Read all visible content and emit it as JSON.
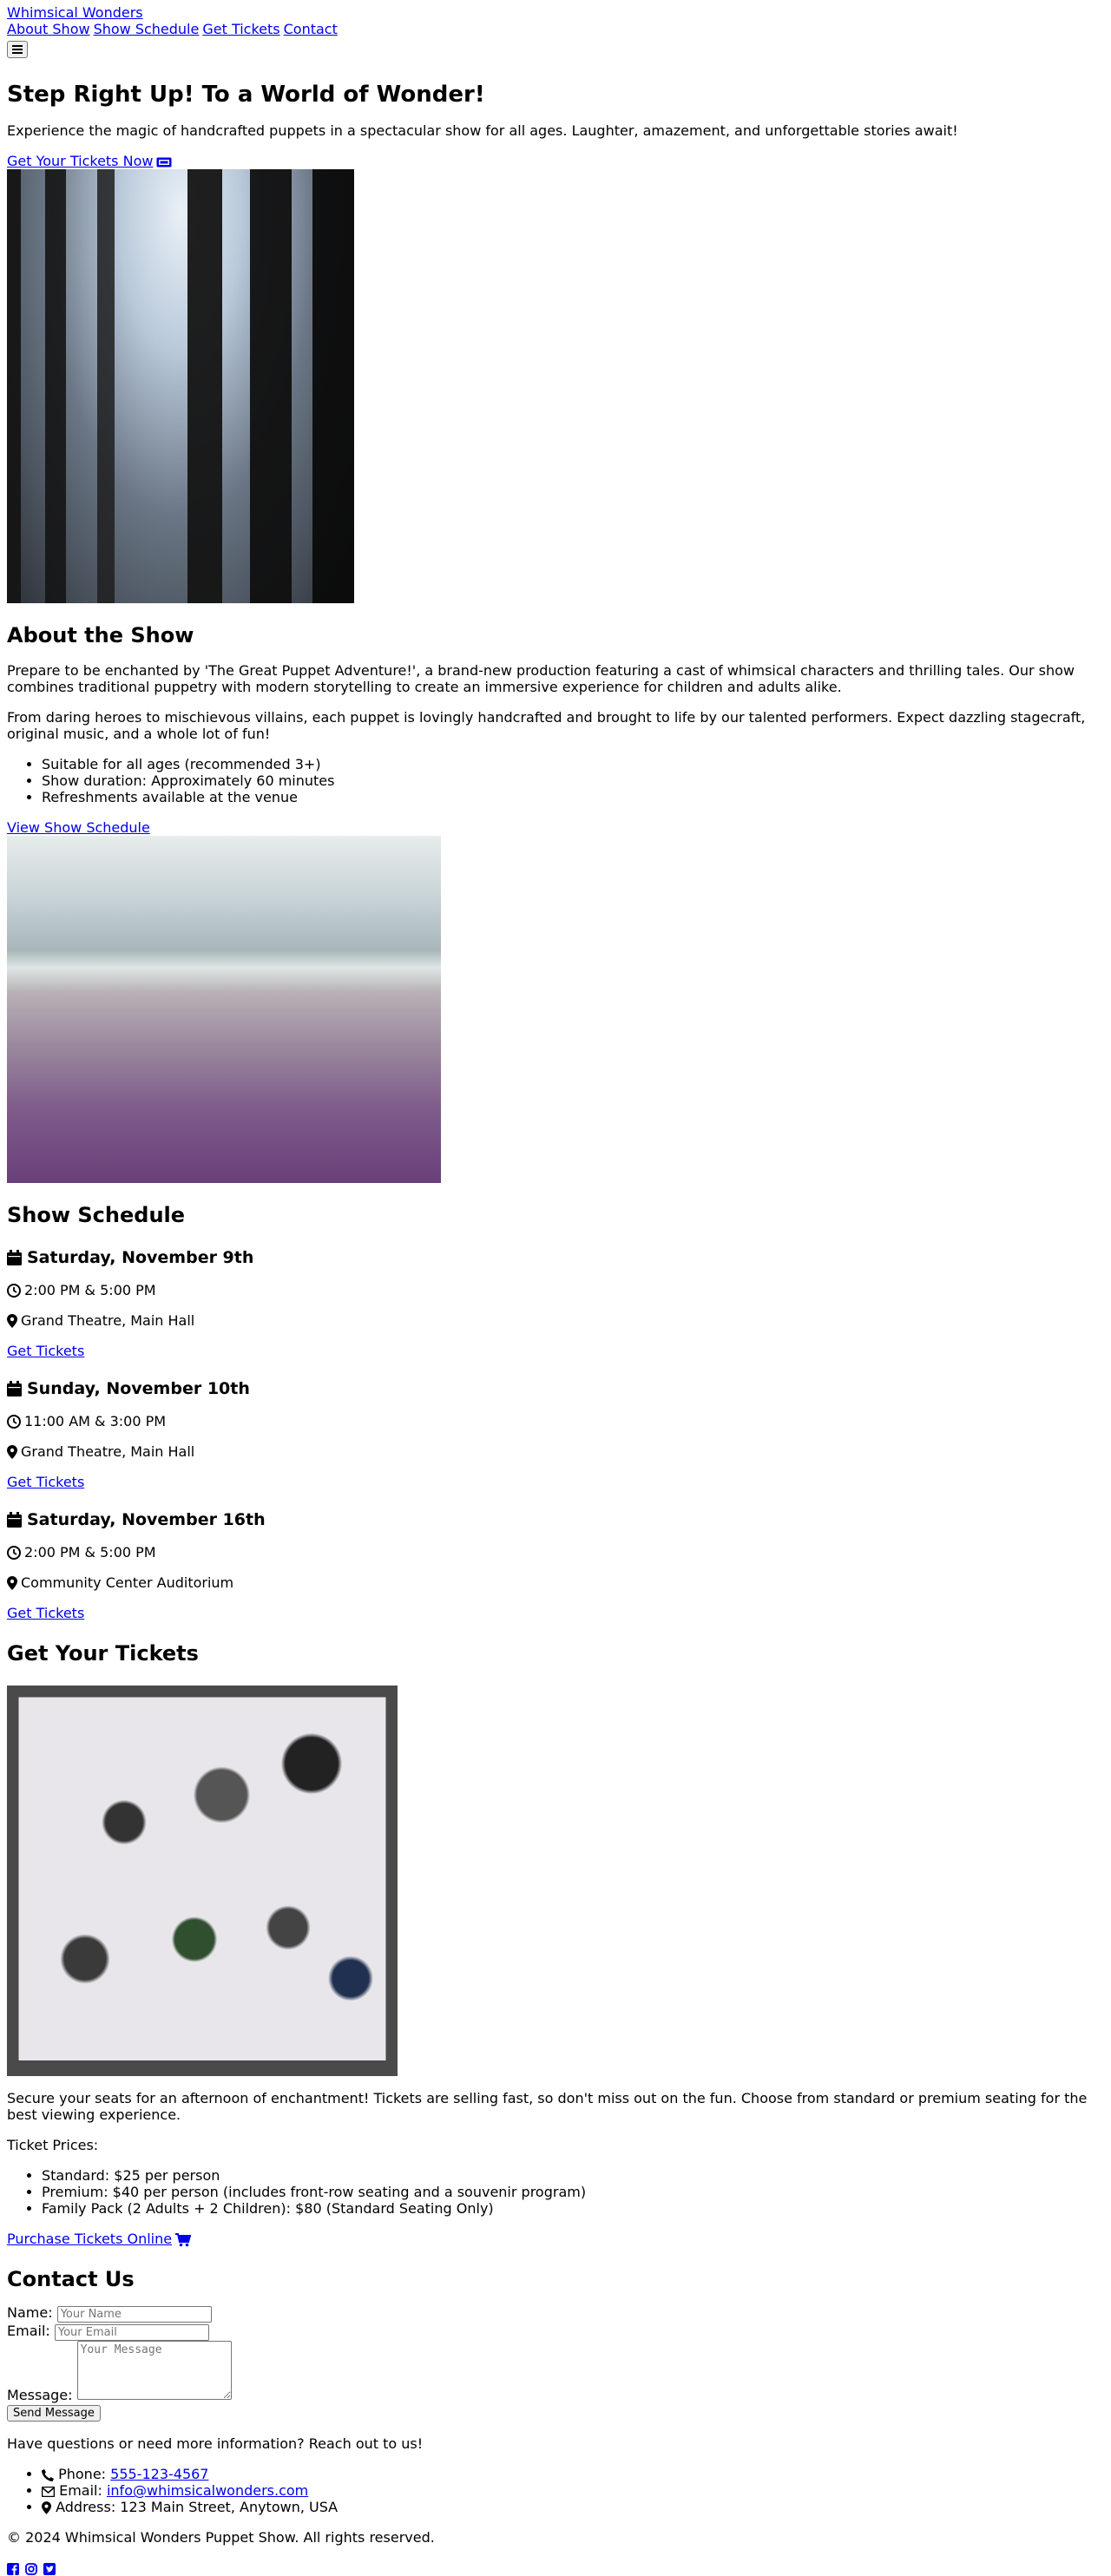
{
  "header": {
    "logo_text": "Whimsical Wonders",
    "nav": [
      "About Show",
      "Show Schedule",
      "Get Tickets",
      "Contact"
    ],
    "menu_icon": "hamburger-icon"
  },
  "hero": {
    "title": "Step Right Up! To a World of Wonder!",
    "subtitle": "Experience the magic of handcrafted puppets in a spectacular show for all ages. Laughter, amazement, and unforgettable stories await!",
    "cta_label": "Get Your Tickets Now",
    "cta_icon": "ticket-icon"
  },
  "about": {
    "title": "About the Show",
    "para1": "Prepare to be enchanted by 'The Great Puppet Adventure!', a brand-new production featuring a cast of whimsical characters and thrilling tales. Our show combines traditional puppetry with modern storytelling to create an immersive experience for children and adults alike.",
    "para2": "From daring heroes to mischievous villains, each puppet is lovingly handcrafted and brought to life by our talented performers. Expect dazzling stagecraft, original music, and a whole lot of fun!",
    "features": [
      "Suitable for all ages (recommended 3+)",
      "Show duration: Approximately 60 minutes",
      "Refreshments available at the venue"
    ],
    "schedule_link": "View Show Schedule"
  },
  "schedule": {
    "title": "Show Schedule",
    "shows": [
      {
        "date": "Saturday, November 9th",
        "time": "2:00 PM & 5:00 PM",
        "venue": "Grand Theatre, Main Hall",
        "link": "Get Tickets"
      },
      {
        "date": "Sunday, November 10th",
        "time": "11:00 AM & 3:00 PM",
        "venue": "Grand Theatre, Main Hall",
        "link": "Get Tickets"
      },
      {
        "date": "Saturday, November 16th",
        "time": "2:00 PM & 5:00 PM",
        "venue": "Community Center Auditorium",
        "link": "Get Tickets"
      }
    ]
  },
  "tickets": {
    "title": "Get Your Tickets",
    "intro": "Secure your seats for an afternoon of enchantment! Tickets are selling fast, so don't miss out on the fun. Choose from standard or premium seating for the best viewing experience.",
    "prices_label": "Ticket Prices:",
    "prices": [
      "Standard: $25 per person",
      "Premium: $40 per person (includes front-row seating and a souvenir program)",
      "Family Pack (2 Adults + 2 Children): $80 (Standard Seating Only)"
    ],
    "purchase_label": "Purchase Tickets Online",
    "purchase_icon": "cart-icon"
  },
  "contact": {
    "title": "Contact Us",
    "name_label": "Name:",
    "name_placeholder": "Your Name",
    "email_label": "Email:",
    "email_placeholder": "Your Email",
    "message_label": "Message:",
    "message_placeholder": "Your Message",
    "submit_label": "Send Message",
    "intro": "Have questions or need more information? Reach out to us!",
    "phone_label": "Phone:",
    "phone": "555-123-4567",
    "email_label2": "Email:",
    "email": "info@whimsicalwonders.com",
    "address_label": "Address:",
    "address": "123 Main Street, Anytown, USA"
  },
  "footer": {
    "copyright": "© 2024 Whimsical Wonders Puppet Show. All rights reserved.",
    "social_icons": [
      "facebook-icon",
      "instagram-icon",
      "twitter-icon"
    ]
  },
  "colors": {
    "link": "#0000ee",
    "text": "#000000",
    "background": "#ffffff"
  }
}
